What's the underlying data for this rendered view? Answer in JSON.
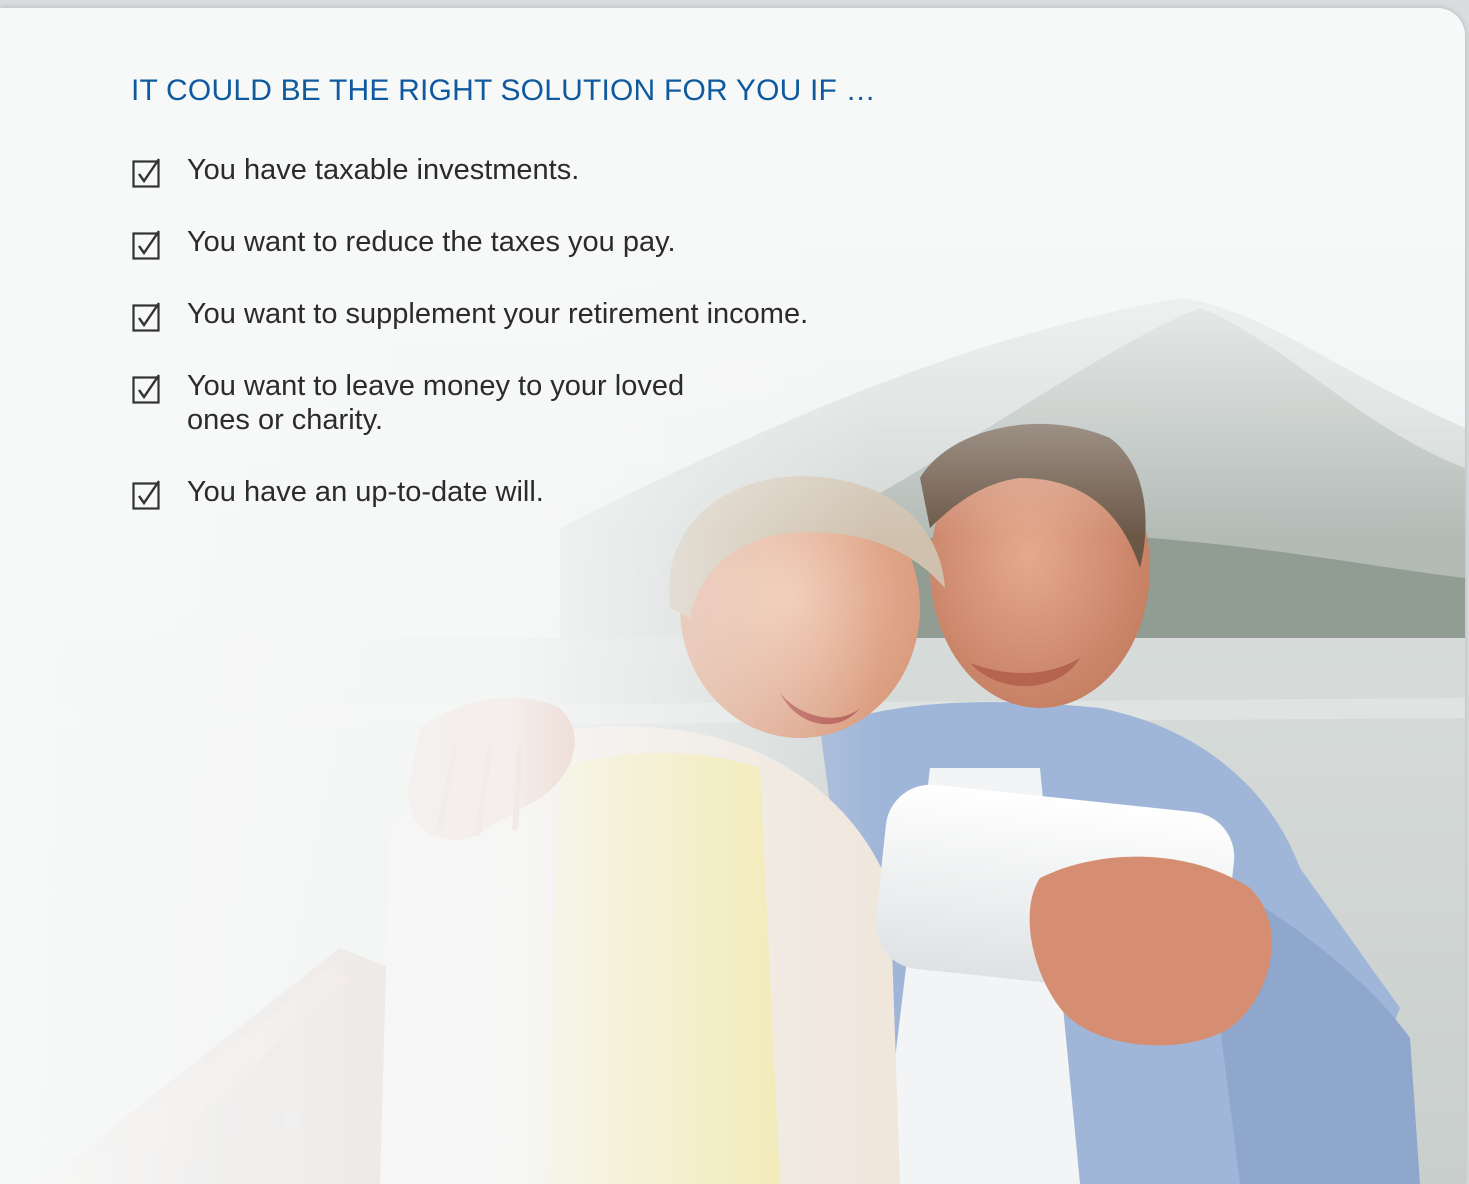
{
  "heading": "IT COULD BE THE RIGHT SOLUTION FOR YOU IF …",
  "checklist": [
    {
      "text": "You have taxable investments.",
      "checked": true
    },
    {
      "text": "You want to reduce the taxes you pay.",
      "checked": true
    },
    {
      "text": "You want to supplement your retirement income.",
      "checked": true
    },
    {
      "text": "You want to leave money to your loved ones or charity.",
      "checked": true
    },
    {
      "text": "You have an up-to-date will.",
      "checked": true
    }
  ],
  "colors": {
    "heading": "#0f5a9e",
    "body_text": "#2b2b2b",
    "page_background": "#f7f8f8"
  },
  "icons": {
    "checkbox": "checked-checkbox-icon"
  }
}
